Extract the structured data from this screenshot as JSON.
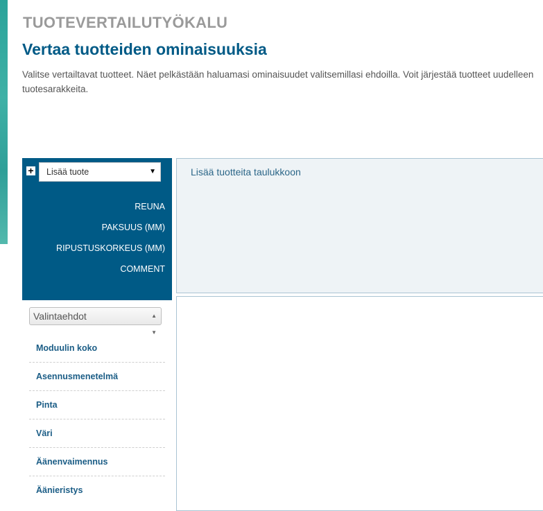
{
  "header": {
    "kicker": "TUOTEVERTAILUTYÖKALU",
    "title": "Vertaa tuotteiden ominaisuuksia",
    "description_line1": "Valitse vertailtavat tuotteet. Näet pelkästään haluamasi ominaisuudet valitsemillasi ehdoilla. Voit järjestää tuotteet uudelleen",
    "description_line2": "tuotesarakkeita."
  },
  "compare_panel": {
    "add_product_placeholder": "Lisää tuote",
    "plus_icon": "+",
    "attributes": [
      "REUNA",
      "PAKSUUS (MM)",
      "RIPUSTUSKORKEUS (MM)",
      "COMMENT"
    ],
    "empty_message": "Lisää tuotteita taulukkoon"
  },
  "filters": {
    "select_label": "Valintaehdot",
    "criteria": [
      "Moduulin koko",
      "Asennusmenetelmä",
      "Pinta",
      "Väri",
      "Äänenvaimennus",
      "Äänieristys"
    ]
  },
  "colors": {
    "brand_blue": "#005a86",
    "panel_bg": "#eef3f6",
    "teal_strip": "#2aa39a"
  }
}
